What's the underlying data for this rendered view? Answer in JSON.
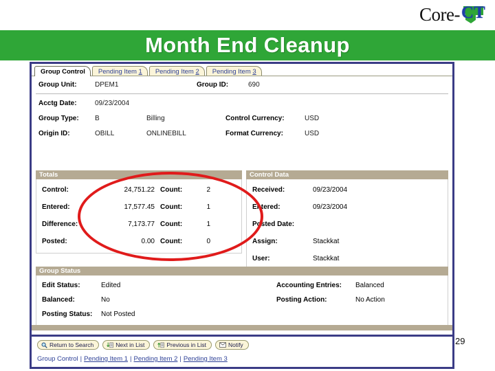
{
  "slide": {
    "title": "Month End Cleanup",
    "page_number": "29",
    "banner_color": "#2fa637",
    "panel_border_color": "#3b3c86",
    "annotation_color": "#e01b1b"
  },
  "logo": {
    "word": "Core-",
    "mark": "CT",
    "mark_color": "#1f3fa8",
    "shape_color": "#2fa637"
  },
  "tabs": [
    {
      "label": "Group Control",
      "active": true
    },
    {
      "label": "Pending Item ",
      "num": "1",
      "active": false
    },
    {
      "label": "Pending Item ",
      "num": "2",
      "active": false
    },
    {
      "label": "Pending Item ",
      "num": "3",
      "active": false
    }
  ],
  "header_fields": {
    "group_unit_label": "Group Unit:",
    "group_unit_value": "DPEM1",
    "group_id_label": "Group ID:",
    "group_id_value": "690",
    "acctg_date_label": "Acctg Date:",
    "acctg_date_value": "09/23/2004",
    "group_type_label": "Group Type:",
    "group_type_code": "B",
    "group_type_desc": "Billing",
    "control_currency_label": "Control Currency:",
    "control_currency_value": "USD",
    "origin_id_label": "Origin ID:",
    "origin_id_code": "OBILL",
    "origin_id_desc": "ONLINEBILL",
    "format_currency_label": "Format Currency:",
    "format_currency_value": "USD"
  },
  "totals": {
    "section_title": "Totals",
    "count_label": "Count:",
    "rows": [
      {
        "label": "Control:",
        "amount": "24,751.22",
        "count": "2"
      },
      {
        "label": "Entered:",
        "amount": "17,577.45",
        "count": "1"
      },
      {
        "label": "Difference:",
        "amount": "7,173.77",
        "count": "1"
      },
      {
        "label": "Posted:",
        "amount": "0.00",
        "count": "0"
      }
    ]
  },
  "control_data": {
    "section_title": "Control Data",
    "rows": [
      {
        "label": "Received:",
        "value": "09/23/2004"
      },
      {
        "label": "Entered:",
        "value": "09/23/2004"
      },
      {
        "label": "Posted Date:",
        "value": ""
      },
      {
        "label": "Assign:",
        "value": "Stackkat"
      },
      {
        "label": "User:",
        "value": "Stackkat"
      }
    ]
  },
  "group_status": {
    "section_title": "Group Status",
    "edit_status_label": "Edit Status:",
    "edit_status_value": "Edited",
    "accounting_entries_label": "Accounting Entries:",
    "accounting_entries_value": "Balanced",
    "balanced_label": "Balanced:",
    "balanced_value": "No",
    "posting_action_label": "Posting Action:",
    "posting_action_value": "No Action",
    "posting_status_label": "Posting Status:",
    "posting_status_value": "Not Posted"
  },
  "toolbar": {
    "return_to_search": "Return to Search",
    "next_in_list": "Next in List",
    "previous_in_list": "Previous in List",
    "notify": "Notify"
  },
  "footer_links": {
    "group_control": "Group Control",
    "pending_item_1": "Pending Item 1",
    "pending_item_2": "Pending Item 2",
    "pending_item_3": "Pending Item 3",
    "separator": "|"
  }
}
